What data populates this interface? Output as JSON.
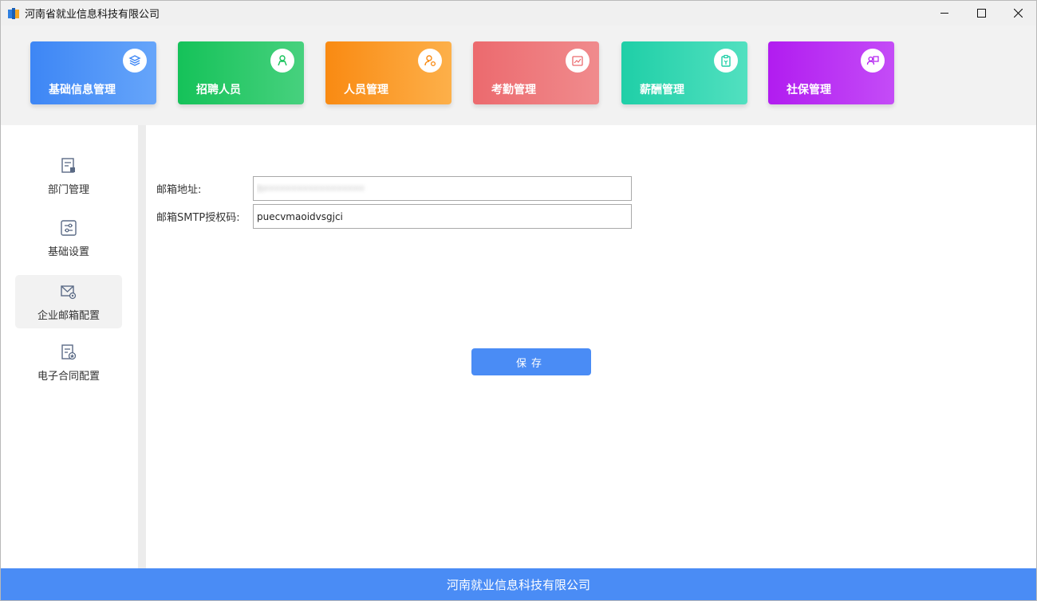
{
  "window": {
    "title": "河南省就业信息科技有限公司",
    "controls": {
      "minimize": "—",
      "maximize": "☐",
      "close": "✕"
    }
  },
  "modules": [
    {
      "label": "基础信息管理",
      "icon": "layers-icon"
    },
    {
      "label": "招聘人员",
      "icon": "person-icon"
    },
    {
      "label": "人员管理",
      "icon": "user-settings-icon"
    },
    {
      "label": "考勤管理",
      "icon": "calendar-chart-icon"
    },
    {
      "label": "薪酬管理",
      "icon": "wallet-icon"
    },
    {
      "label": "社保管理",
      "icon": "id-card-icon"
    }
  ],
  "sidebar": {
    "items": [
      {
        "label": "部门管理",
        "icon": "document-icon",
        "active": false
      },
      {
        "label": "基础设置",
        "icon": "sliders-icon",
        "active": false
      },
      {
        "label": "企业邮箱配置",
        "icon": "mail-gear-icon",
        "active": true
      },
      {
        "label": "电子合同配置",
        "icon": "contract-icon",
        "active": false
      }
    ]
  },
  "form": {
    "email_label": "邮箱地址:",
    "email_value": "h••••••••••••••••••",
    "smtp_label": "邮箱SMTP授权码:",
    "smtp_value": "puecvmaoidvsgjci",
    "save_label": "保存"
  },
  "footer": {
    "text": "河南就业信息科技有限公司"
  },
  "colors": {
    "primary": "#4a8cf5",
    "module_blue": "#3d86f5",
    "module_green": "#15c259",
    "module_orange": "#f98a12",
    "module_red": "#ec6a6e",
    "module_teal": "#1fcfa7",
    "module_purple": "#b11cf0"
  }
}
